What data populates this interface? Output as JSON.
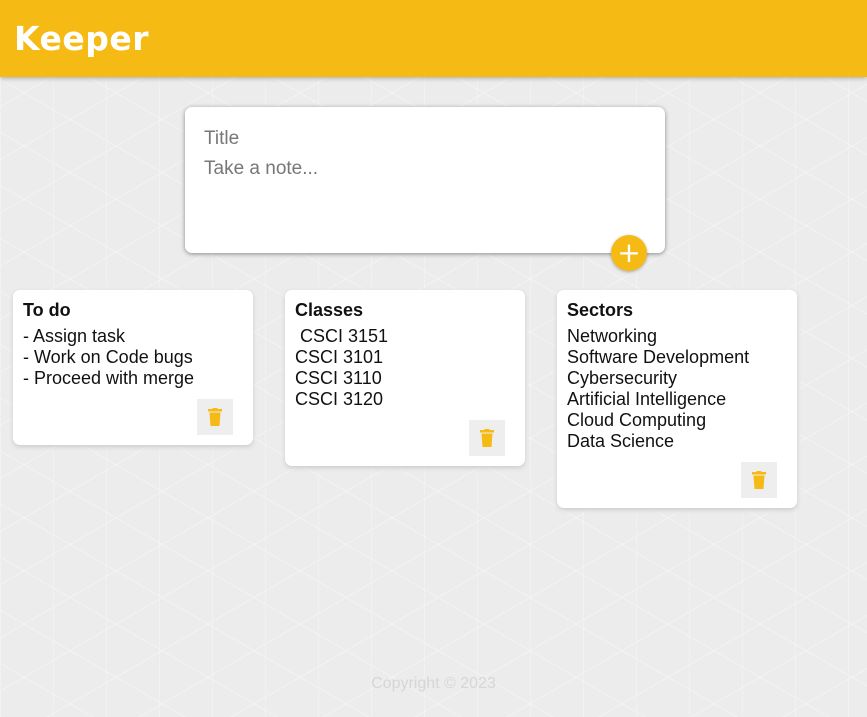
{
  "header": {
    "title": "Keeper"
  },
  "create_form": {
    "title_placeholder": "Title",
    "content_placeholder": "Take a note...",
    "add_icon": "plus-icon"
  },
  "notes": [
    {
      "title": "To do",
      "content": "- Assign task\n- Work on Code bugs\n- Proceed with merge",
      "delete_icon": "trash-icon"
    },
    {
      "title": "Classes",
      "content": " CSCI 3151\nCSCI 3101\nCSCI 3110\nCSCI 3120",
      "delete_icon": "trash-icon"
    },
    {
      "title": "Sectors",
      "content": "Networking\nSoftware Development\nCybersecurity\nArtificial Intelligence\nCloud Computing\nData Science",
      "delete_icon": "trash-icon"
    }
  ],
  "footer": {
    "text": "Copyright © 2023"
  },
  "colors": {
    "accent": "#f5ba13",
    "background": "#ececec",
    "card": "#ffffff",
    "footer_text": "#d6d6d6"
  }
}
